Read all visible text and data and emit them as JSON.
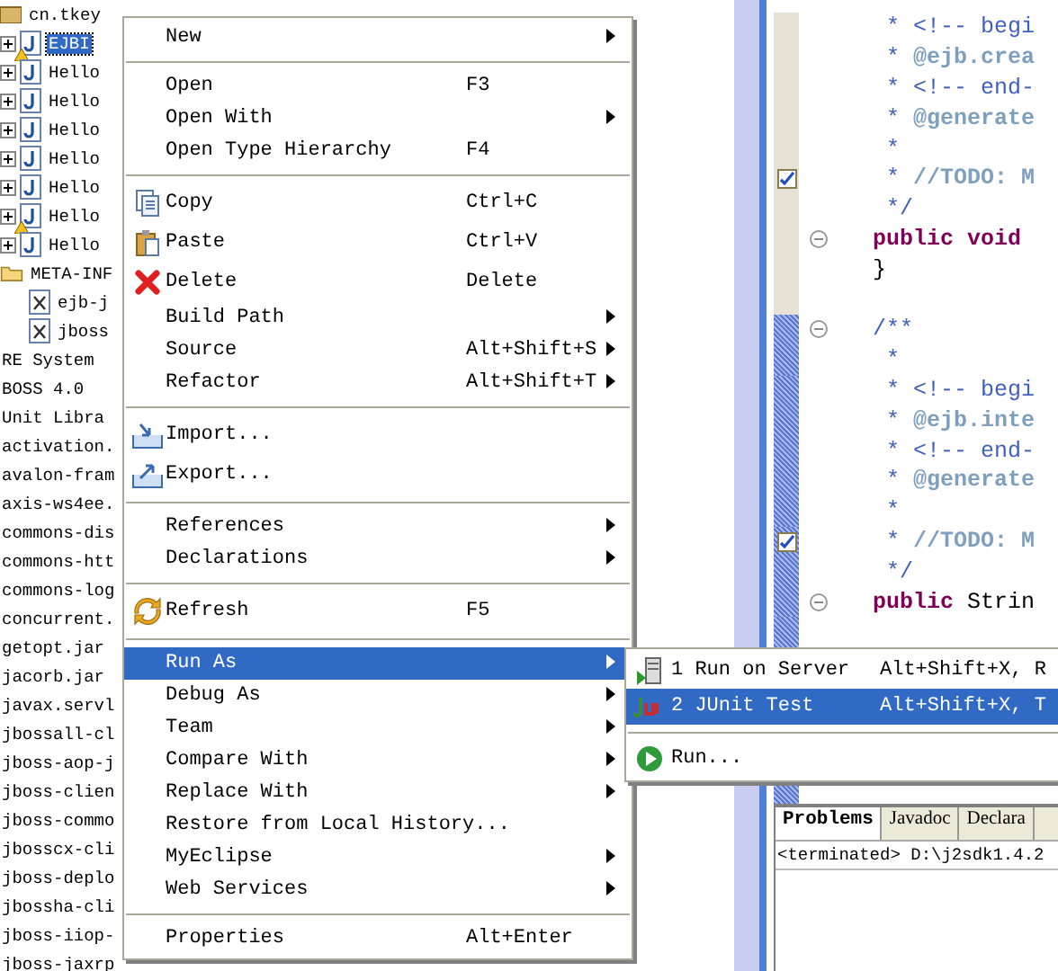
{
  "tree": [
    {
      "label": "cn.tkey",
      "kind": "package",
      "expanded": true,
      "children": [
        {
          "label": "EJBI",
          "kind": "java",
          "expanded": false,
          "selected": true,
          "warning": true
        },
        {
          "label": "Hello",
          "kind": "java",
          "expanded": false,
          "selected": false,
          "warning": false
        },
        {
          "label": "Hello",
          "kind": "java",
          "expanded": false,
          "selected": false,
          "warning": false
        },
        {
          "label": "Hello",
          "kind": "java",
          "expanded": false,
          "selected": false,
          "warning": false
        },
        {
          "label": "Hello",
          "kind": "java",
          "expanded": false,
          "selected": false,
          "warning": false
        },
        {
          "label": "Hello",
          "kind": "java",
          "expanded": false,
          "selected": false,
          "warning": false
        },
        {
          "label": "Hello",
          "kind": "java",
          "expanded": false,
          "selected": false,
          "warning": true
        },
        {
          "label": "Hello",
          "kind": "java",
          "expanded": false,
          "selected": false,
          "warning": false
        }
      ]
    },
    {
      "label": "META-INF",
      "kind": "folder",
      "expanded": true,
      "children": [
        {
          "label": "ejb-j",
          "kind": "xml"
        },
        {
          "label": "jboss",
          "kind": "xml"
        }
      ]
    },
    {
      "label": "RE System",
      "kind": "library"
    },
    {
      "label": "BOSS 4.0",
      "kind": "library"
    },
    {
      "label": "Unit Libra",
      "kind": "library"
    },
    {
      "label": "activation.",
      "kind": "library"
    },
    {
      "label": "avalon-fram",
      "kind": "library"
    },
    {
      "label": "axis-ws4ee.",
      "kind": "library"
    },
    {
      "label": "commons-dis",
      "kind": "library"
    },
    {
      "label": "commons-htt",
      "kind": "library"
    },
    {
      "label": "commons-log",
      "kind": "library"
    },
    {
      "label": "concurrent.",
      "kind": "library"
    },
    {
      "label": "getopt.jar",
      "kind": "library"
    },
    {
      "label": "jacorb.jar",
      "kind": "library"
    },
    {
      "label": "javax.servl",
      "kind": "library"
    },
    {
      "label": "jbossall-cl",
      "kind": "library"
    },
    {
      "label": "jboss-aop-j",
      "kind": "library"
    },
    {
      "label": "jboss-clien",
      "kind": "library"
    },
    {
      "label": "jboss-commo",
      "kind": "library"
    },
    {
      "label": "jbosscx-cli",
      "kind": "library"
    },
    {
      "label": "jboss-deplo",
      "kind": "library"
    },
    {
      "label": "jbossha-cli",
      "kind": "library"
    },
    {
      "label": "jboss-iiop-",
      "kind": "library"
    },
    {
      "label": "jboss-jaxrp",
      "kind": "library"
    }
  ],
  "code_lines": [
    {
      "segments": [
        {
          "text": " * <!-- begi",
          "kind": "comment"
        }
      ],
      "fold": false,
      "task": false,
      "range": false
    },
    {
      "segments": [
        {
          "text": " * ",
          "kind": "comment"
        },
        {
          "text": "@ejb.crea",
          "kind": "tag"
        }
      ],
      "fold": false,
      "task": false,
      "range": false
    },
    {
      "segments": [
        {
          "text": " * <!-- end-",
          "kind": "comment"
        }
      ],
      "fold": false,
      "task": false,
      "range": false
    },
    {
      "segments": [
        {
          "text": " * ",
          "kind": "comment"
        },
        {
          "text": "@generate",
          "kind": "tag"
        }
      ],
      "fold": false,
      "task": false,
      "range": false
    },
    {
      "segments": [
        {
          "text": " *",
          "kind": "comment"
        }
      ],
      "fold": false,
      "task": false,
      "range": false
    },
    {
      "segments": [
        {
          "text": " * ",
          "kind": "comment"
        },
        {
          "text": "//TODO: M",
          "kind": "tag"
        }
      ],
      "fold": false,
      "task": true,
      "range": false
    },
    {
      "segments": [
        {
          "text": " */",
          "kind": "comment"
        }
      ],
      "fold": false,
      "task": false,
      "range": false
    },
    {
      "segments": [
        {
          "text": "public void",
          "kind": "keyword"
        }
      ],
      "fold": true,
      "task": false,
      "range": false
    },
    {
      "segments": [
        {
          "text": "}",
          "kind": "plain"
        }
      ],
      "fold": false,
      "task": false,
      "range": false
    },
    {
      "fold": false,
      "task": false,
      "range": false
    },
    {
      "segments": [
        {
          "text": "/**",
          "kind": "comment"
        }
      ],
      "fold": true,
      "task": false,
      "range": true
    },
    {
      "segments": [
        {
          "text": " *",
          "kind": "comment"
        }
      ],
      "fold": false,
      "task": false,
      "range": true
    },
    {
      "segments": [
        {
          "text": " * <!-- begi",
          "kind": "comment"
        }
      ],
      "fold": false,
      "task": false,
      "range": true
    },
    {
      "segments": [
        {
          "text": " * ",
          "kind": "comment"
        },
        {
          "text": "@ejb.inte",
          "kind": "tag"
        }
      ],
      "fold": false,
      "task": false,
      "range": true
    },
    {
      "segments": [
        {
          "text": " * <!-- end-",
          "kind": "comment"
        }
      ],
      "fold": false,
      "task": false,
      "range": true
    },
    {
      "segments": [
        {
          "text": " * ",
          "kind": "comment"
        },
        {
          "text": "@generate",
          "kind": "tag"
        }
      ],
      "fold": false,
      "task": false,
      "range": true
    },
    {
      "segments": [
        {
          "text": " *",
          "kind": "comment"
        }
      ],
      "fold": false,
      "task": false,
      "range": true
    },
    {
      "segments": [
        {
          "text": " * ",
          "kind": "comment"
        },
        {
          "text": "//TODO: M",
          "kind": "tag"
        }
      ],
      "fold": false,
      "task": true,
      "range": true
    },
    {
      "segments": [
        {
          "text": " */",
          "kind": "comment"
        }
      ],
      "fold": false,
      "task": false,
      "range": true
    },
    {
      "segments": [
        {
          "text": "public",
          "kind": "keyword"
        },
        {
          "text": " Strin",
          "kind": "plain"
        }
      ],
      "fold": true,
      "task": false,
      "range": true
    }
  ],
  "bottom_panel": {
    "tabs": [
      {
        "label": "Problems",
        "selected": true
      },
      {
        "label": "Javadoc",
        "selected": false
      },
      {
        "label": "Declara",
        "selected": false
      }
    ],
    "console_text": "<terminated> D:\\j2sdk1.4.2"
  },
  "context_menu": [
    {
      "kind": "item",
      "label": "New",
      "submenu": true,
      "selected": false
    },
    {
      "kind": "separator"
    },
    {
      "kind": "item",
      "label": "Open",
      "shortcut": "F3",
      "submenu": false,
      "selected": false
    },
    {
      "kind": "item",
      "label": "Open With",
      "submenu": true,
      "selected": false
    },
    {
      "kind": "item",
      "label": "Open Type Hierarchy",
      "shortcut": "F4",
      "submenu": false,
      "selected": false
    },
    {
      "kind": "separator"
    },
    {
      "kind": "copy",
      "label": "Copy",
      "shortcut": "Ctrl+C",
      "submenu": false,
      "selected": false
    },
    {
      "kind": "paste",
      "label": "Paste",
      "shortcut": "Ctrl+V",
      "submenu": false,
      "selected": false
    },
    {
      "kind": "delete",
      "label": "Delete",
      "shortcut": "Delete",
      "submenu": false,
      "selected": false
    },
    {
      "kind": "item",
      "label": "Build Path",
      "submenu": true,
      "selected": false
    },
    {
      "kind": "item",
      "label": "Source",
      "shortcut": "Alt+Shift+S",
      "submenu": true,
      "selected": false
    },
    {
      "kind": "item",
      "label": "Refactor",
      "shortcut": "Alt+Shift+T",
      "submenu": true,
      "selected": false
    },
    {
      "kind": "separator"
    },
    {
      "kind": "import",
      "label": "Import...",
      "submenu": false,
      "selected": false
    },
    {
      "kind": "export",
      "label": "Export...",
      "submenu": false,
      "selected": false
    },
    {
      "kind": "separator"
    },
    {
      "kind": "item",
      "label": "References",
      "submenu": true,
      "selected": false
    },
    {
      "kind": "item",
      "label": "Declarations",
      "submenu": true,
      "selected": false
    },
    {
      "kind": "separator"
    },
    {
      "kind": "refresh",
      "label": "Refresh",
      "shortcut": "F5",
      "submenu": false,
      "selected": false
    },
    {
      "kind": "separator"
    },
    {
      "kind": "item",
      "label": "Run As",
      "submenu": true,
      "selected": true
    },
    {
      "kind": "item",
      "label": "Debug As",
      "submenu": true,
      "selected": false
    },
    {
      "kind": "item",
      "label": "Team",
      "submenu": true,
      "selected": false
    },
    {
      "kind": "item",
      "label": "Compare With",
      "submenu": true,
      "selected": false
    },
    {
      "kind": "item",
      "label": "Replace With",
      "submenu": true,
      "selected": false
    },
    {
      "kind": "item",
      "label": "Restore from Local History...",
      "submenu": false,
      "selected": false
    },
    {
      "kind": "item",
      "label": "MyEclipse",
      "submenu": true,
      "selected": false
    },
    {
      "kind": "item",
      "label": "Web Services",
      "submenu": true,
      "selected": false
    },
    {
      "kind": "separator"
    },
    {
      "kind": "item",
      "label": "Properties",
      "shortcut": "Alt+Enter",
      "submenu": false,
      "selected": false
    }
  ],
  "run_as_submenu": [
    {
      "kind": "server",
      "label": "1 Run on Server",
      "shortcut": "Alt+Shift+X, R",
      "selected": false
    },
    {
      "kind": "junit",
      "label": "2 JUnit Test",
      "shortcut": "Alt+Shift+X, T",
      "selected": true
    },
    {
      "kind": "separator"
    },
    {
      "kind": "run",
      "label": "Run...",
      "selected": false
    }
  ]
}
